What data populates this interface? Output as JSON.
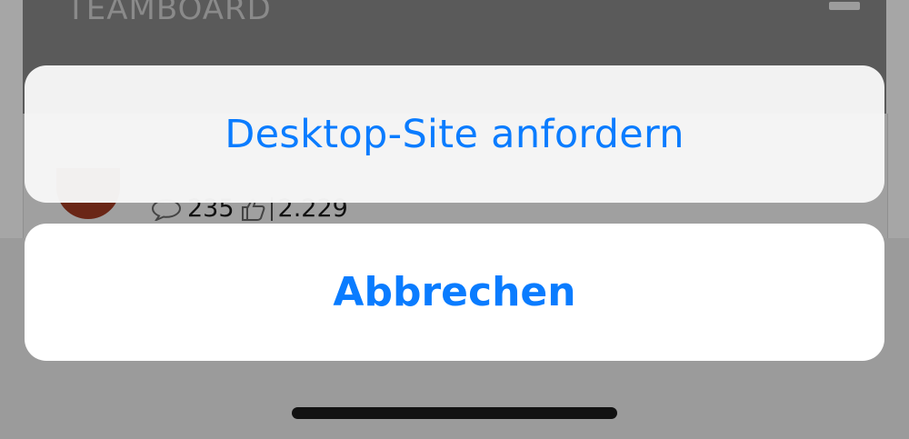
{
  "background": {
    "header_title": "TEAMBOARD",
    "menu_icon": "hamburger-icon",
    "stats": {
      "comments_icon": "comment-bubble-icon",
      "comments_count": "235",
      "likes_icon": "thumbs-up-icon",
      "likes_count": "2.229"
    }
  },
  "action_sheet": {
    "option_label": "Desktop-Site anfordern",
    "cancel_label": "Abbrechen"
  },
  "colors": {
    "accent": "#0a7cff",
    "overlay": "#9b9b9b"
  }
}
